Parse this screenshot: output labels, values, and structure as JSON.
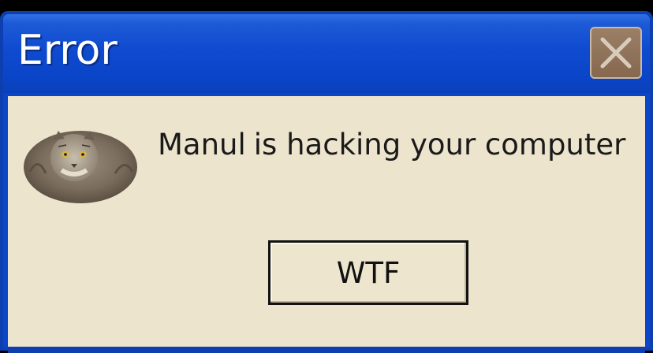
{
  "dialog": {
    "title": "Error",
    "message_name": "Manul",
    "message_text": "is hacking your computer",
    "button_label": "WTF",
    "icon": "manul-cat-icon",
    "close_icon": "close-icon"
  },
  "colors": {
    "titlebar": "#0a47c8",
    "body": "#ece4cc",
    "close_button": "#8f735a"
  }
}
